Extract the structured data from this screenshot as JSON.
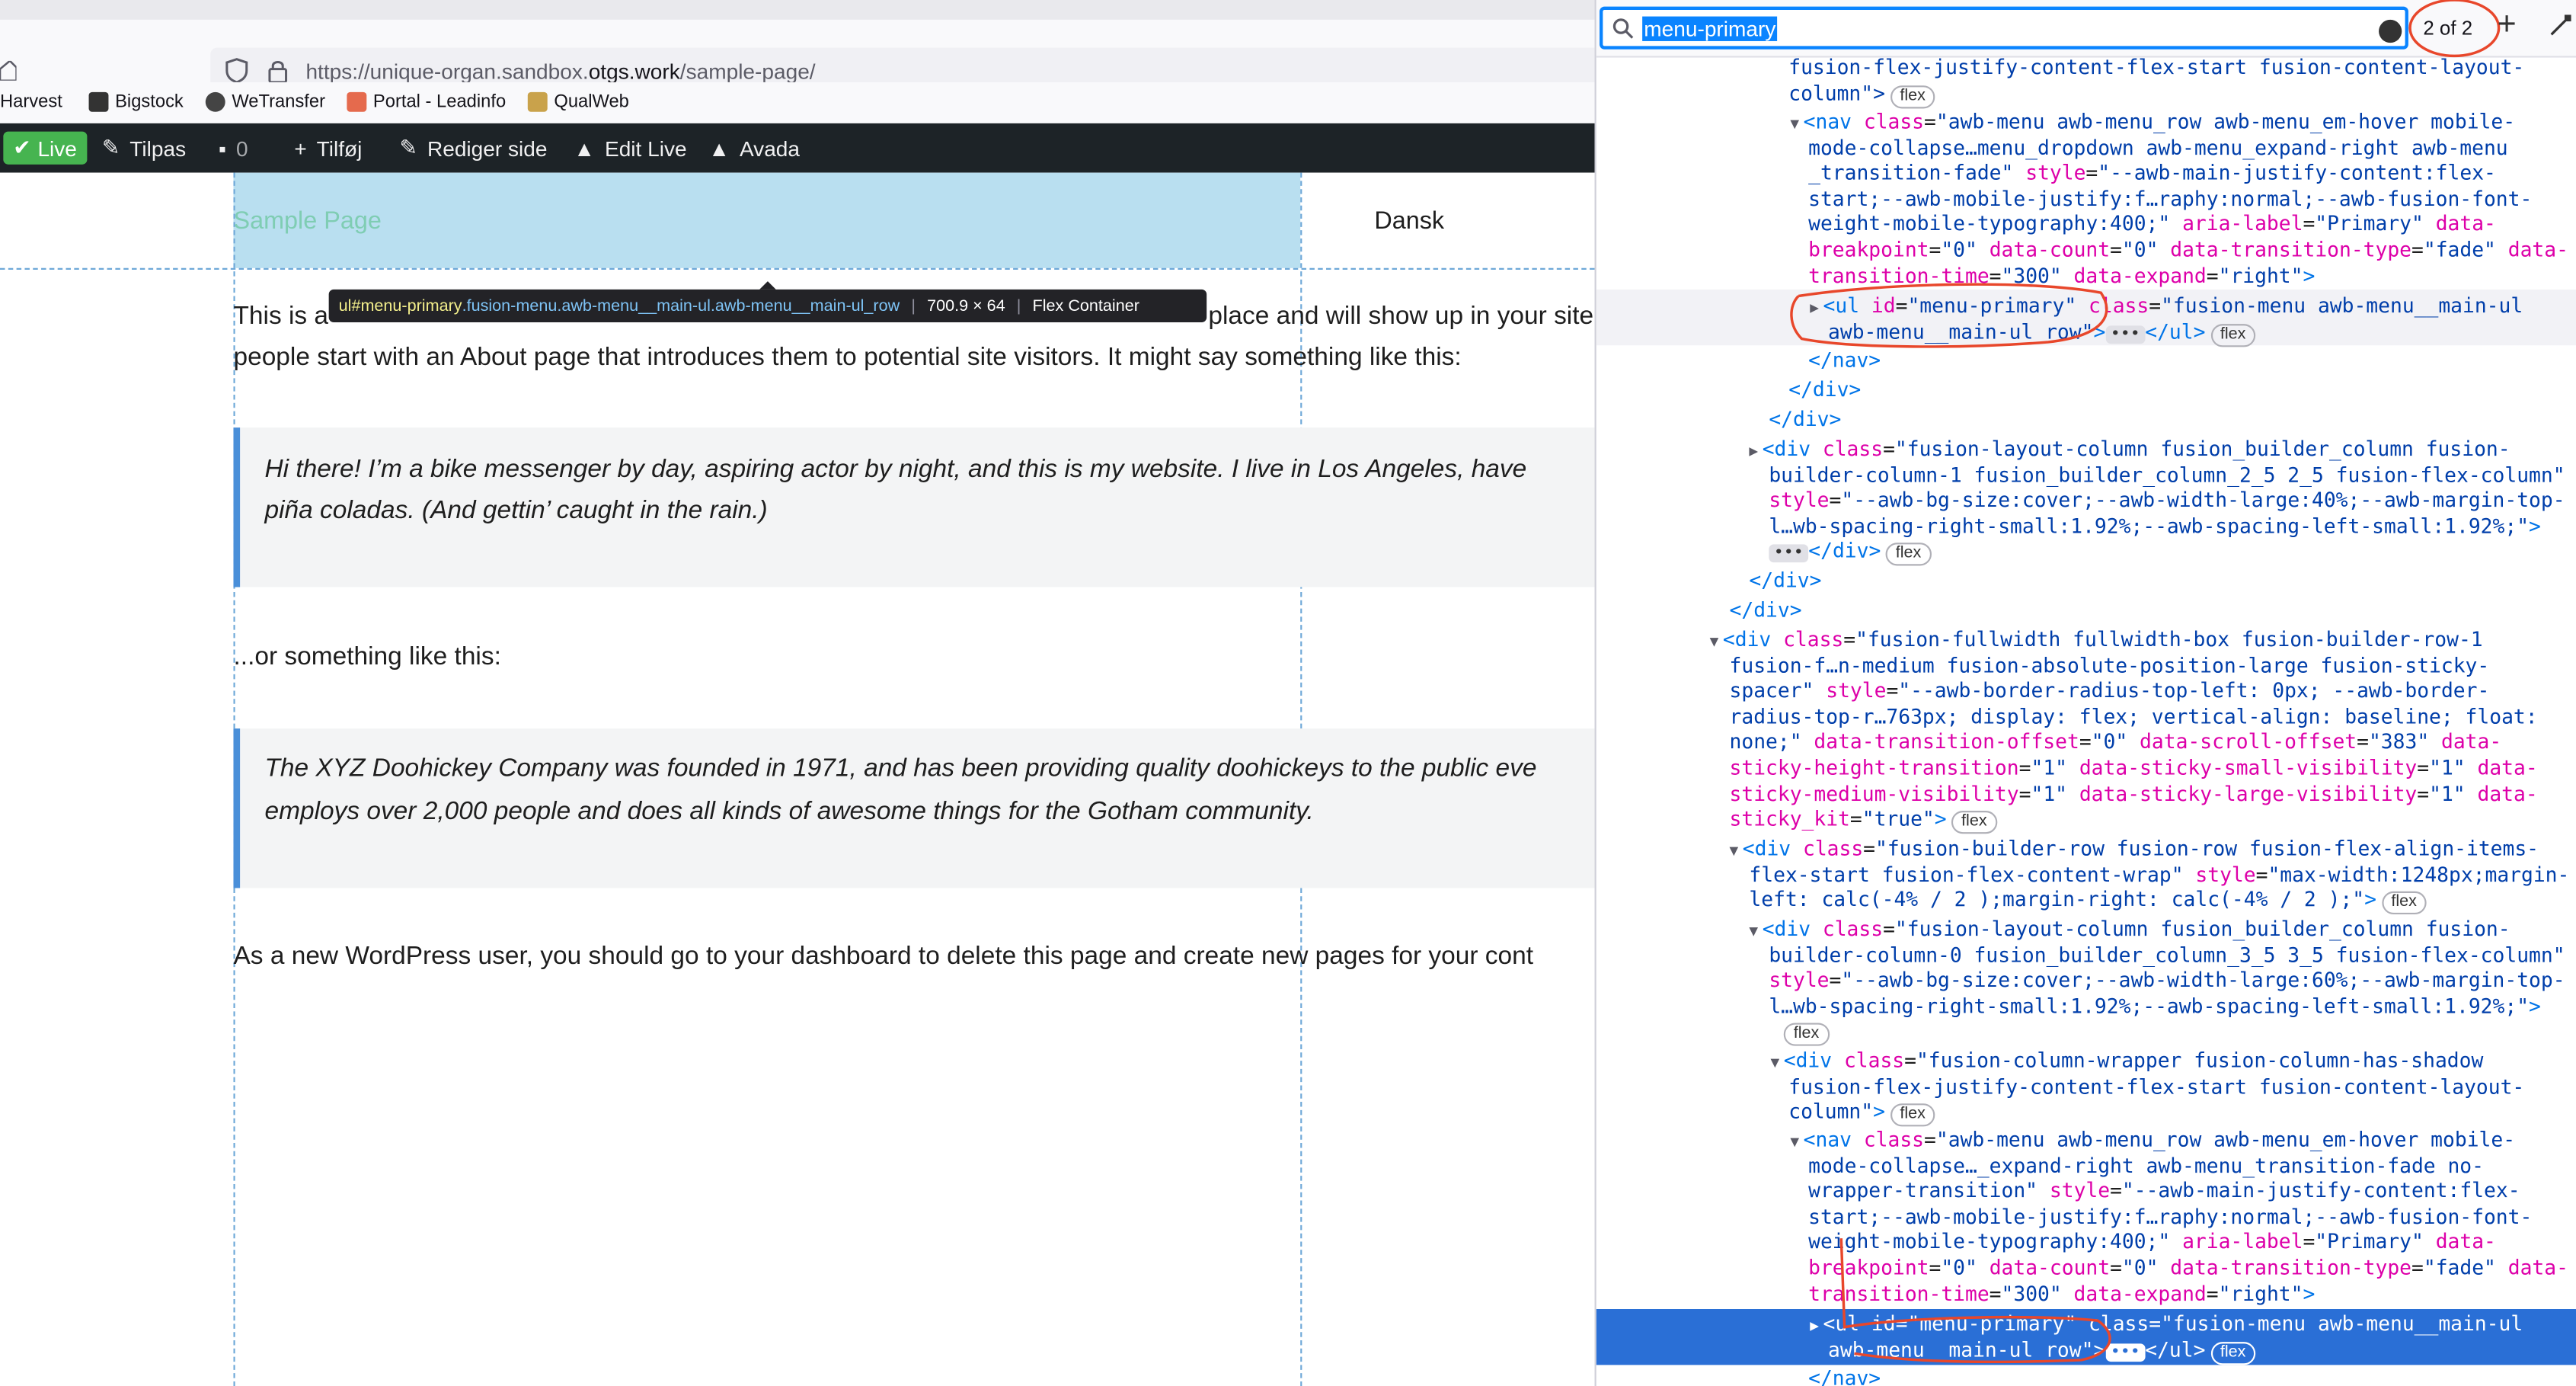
{
  "browser": {
    "url_prefix": "https://unique-organ.sandbox.",
    "url_domain": "otgs.work",
    "url_suffix": "/sample-page/",
    "bookmarks": [
      "Harvest",
      "Bigstock",
      "WeTransfer",
      "Portal - Leadinfo",
      "QualWeb"
    ],
    "colors": {
      "accent": "#0a84ff",
      "selection": "#2a6fd6"
    }
  },
  "adminbar": {
    "live": "Live",
    "customize": "Tilpas",
    "comments": "0",
    "add": "Tilføj",
    "edit_page": "Rediger side",
    "edit_live": "Edit Live",
    "avada": "Avada"
  },
  "page": {
    "menu_item": "Sample Page",
    "language": "Dansk",
    "tooltip": {
      "tag": "ul",
      "id": "#menu-primary",
      "classes": ".fusion-menu.awb-menu__main-ul.awb-menu__main-ul_row",
      "size": "700.9 × 64",
      "type": "Flex Container"
    },
    "p1_a": "This is a",
    "p1_b": "place and will show up in your site",
    "p1_line2": "people start with an About page that introduces them to potential site visitors. It might say something like this:",
    "quote1_line1": "Hi there! I’m a bike messenger by day, aspiring actor by night, and this is my website. I live in Los Angeles, have",
    "quote1_line2": "piña coladas. (And gettin’ caught in the rain.)",
    "p2": "...or something like this:",
    "quote2_line1": "The XYZ Doohickey Company was founded in 1971, and has been providing quality doohickeys to the public eve",
    "quote2_line2": "employs over 2,000 people and does all kinds of awesome things for the Gotham community.",
    "p3": "As a new WordPress user, you should go to your dashboard to delete this page and create new pages for your cont"
  },
  "devtools": {
    "search_query": "menu-primary",
    "match_count": "2 of 2",
    "flex_badge": "flex",
    "lines": {
      "l1": "fusion-flex-justify-content-flex-start fusion-content-layout-",
      "l2": "column\">",
      "nav1_a": "awb-menu awb-menu_row awb-menu_em-hover mobile-",
      "nav1_b": "mode-collapse…menu_dropdown awb-menu_expand-right awb-menu",
      "nav1_c": "_transition-fade\"",
      "nav1_d": "\"--awb-main-justify-content:flex-",
      "nav1_e": "start;--awb-mobile-justify:f…raphy:normal;--awb-fusion-font-",
      "nav1_f": "weight-mobile-typography:400;\"",
      "nav1_g": "\"Primary\"",
      "nav1_h": "\"0\"",
      "nav1_i": "\"0\"",
      "nav1_j": "\"fade\"",
      "nav1_k": "\"300\"",
      "nav1_l": "\"right\"",
      "ul_id": "\"menu-primary\"",
      "ul_class_a": "\"fusion-menu awb-menu__main-ul",
      "ul_class_b": "awb-menu__main-ul_row\"",
      "col1_a": "\"fusion-layout-column fusion_builder_column fusion-",
      "col1_b": "builder-column-1 fusion_builder_column_2_5 2_5 fusion-flex-column\"",
      "col1_c": "\"--awb-bg-size:cover;--awb-width-large:40%;--awb-margin-top-",
      "col1_d": "l…wb-spacing-right-small:1.92%;--awb-spacing-left-small:1.92%;\"",
      "fw_a": "\"fusion-fullwidth fullwidth-box fusion-builder-row-1",
      "fw_b": "fusion-f…n-medium fusion-absolute-position-large fusion-sticky-",
      "fw_c": "spacer\"",
      "fw_d": "\"--awb-border-radius-top-left: 0px; --awb-border-",
      "fw_e": "radius-top-r…763px; display: flex; vertical-align: baseline; float:",
      "fw_f": "none;\"",
      "fw_g": "\"0\"",
      "fw_h": "\"383\"",
      "fw_i": "\"1\"",
      "fw_j": "\"1\"",
      "fw_k": "\"1\"",
      "fw_l": "\"1\"",
      "fw_m": "\"true\"",
      "row_a": "\"fusion-builder-row fusion-row fusion-flex-align-items-",
      "row_b": "flex-start fusion-flex-content-wrap\"",
      "row_c": "\"max-width:1248px;margin-",
      "row_d": "left: calc(-4% / 2 );margin-right: calc(-4% / 2 );\"",
      "col0_a": "\"fusion-layout-column fusion_builder_column fusion-",
      "col0_b": "builder-column-0 fusion_builder_column_3_5 3_5 fusion-flex-column\"",
      "col0_c": "\"--awb-bg-size:cover;--awb-width-large:60%;--awb-margin-top-",
      "col0_d": "l…wb-spacing-right-small:1.92%;--awb-spacing-left-small:1.92%;\"",
      "wrap_a": "\"fusion-column-wrapper fusion-column-has-shadow",
      "wrap_b": "fusion-flex-justify-content-flex-start fusion-content-layout-",
      "wrap_c": "column\"",
      "nav2_a": "awb-menu awb-menu_row awb-menu_em-hover mobile-",
      "nav2_b": "mode-collapse…_expand-right awb-menu_transition-fade no-",
      "nav2_c": "wrapper-transition\"",
      "nav2_d": "\"--awb-main-justify-content:flex-",
      "nav2_e": "start;--awb-mobile-justify:f…raphy:normal;--awb-fusion-font-",
      "nav2_f": "weight-mobile-typography:400;\"",
      "nav2_g": "\"Primary\"",
      "nav2_h": "\"0\"",
      "nav2_i": "\"0\"",
      "nav2_j": "\"fade\"",
      "nav2_k": "\"300\"",
      "nav2_l": "\"right\""
    }
  }
}
